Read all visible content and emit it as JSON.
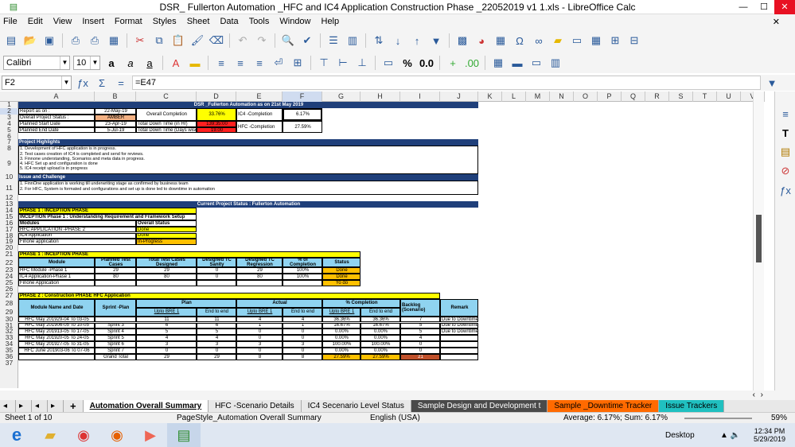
{
  "window": {
    "title": "DSR_ Fullerton Automation _HFC and IC4 Application Construction Phase _22052019 v1 1.xls - LibreOffice Calc"
  },
  "menu": [
    "File",
    "Edit",
    "View",
    "Insert",
    "Format",
    "Styles",
    "Sheet",
    "Data",
    "Tools",
    "Window",
    "Help"
  ],
  "font": {
    "name": "Calibri",
    "size": "10"
  },
  "formula": {
    "cellref": "F2",
    "content": "=E47"
  },
  "columns": [
    "A",
    "B",
    "C",
    "D",
    "E",
    "F",
    "G",
    "H",
    "I",
    "J",
    "K",
    "L",
    "M",
    "N",
    "O",
    "P",
    "Q",
    "R",
    "S",
    "T",
    "U",
    "V"
  ],
  "rows": [
    "1",
    "2",
    "3",
    "4",
    "5",
    "6",
    "7",
    "8",
    "9",
    "10",
    "11",
    "12",
    "13",
    "14",
    "15",
    "16",
    "17",
    "18",
    "19",
    "20",
    "21",
    "22",
    "23",
    "24",
    "25",
    "26",
    "27",
    "28",
    "29",
    "30",
    "31",
    "32",
    "33",
    "34",
    "35",
    "36",
    "37"
  ],
  "sheet": {
    "title": "DSR _Fullerton  Automation as on 21st May 2019",
    "report_as_on_label": "Report as on :",
    "report_as_on": "22-May-19",
    "overall_status_label": "Overall Project Status :",
    "overall_status": "AMBER",
    "planned_start_label": "Planned Start Date",
    "planned_start": "23-Apr-19",
    "planned_end_label": "Planned End Date",
    "planned_end": "5-Jul-19",
    "overall_completion_label": "Overall Completion",
    "overall_completion": "33.76%",
    "downtime_hr_label": "Total Down Time (in Hr)",
    "downtime_hr": "139:35:00",
    "downtime_days_label": "Total Down Time (Days wise)",
    "downtime_days": "19.00",
    "ic4_completion_label": "IC4 -Completion",
    "ic4_completion": "6.17%",
    "hfc_completion_label": "HFC -Completion",
    "hfc_completion": "27.59%",
    "highlights_label": "Project Highlights",
    "highlights": [
      "1. Development of HFC application is in progress.",
      "2. Test cases creation of IC4 is completed and send for reviews.",
      "3. Finnone understanding, Scenarios and meta data in progress.",
      "4. HFC Set up and configuration is done",
      "5. IC4 receipt upload is in progress"
    ],
    "issue_label": "Issue and Challenge",
    "issues": [
      "1. FinnOne application is working till underwriting stage as confirmed by business team",
      "2. For HFC, System is formated and configurations and set up is done led to downtime in automation"
    ],
    "current_status": "Current Project Status : Fullerton Automation",
    "phase1_label": "PHASE 1 : INCEPTION PHASE",
    "phase1_sub": "INCEPTION Phase  1 : Understanding Requirement and Framework Setup",
    "mod_hdr": "Modules",
    "ovs_hdr": "Overall Status",
    "mods": [
      {
        "name": "HFC APPLICATION -PHASE 2",
        "status": "Done"
      },
      {
        "name": "IC4 Application",
        "status": "Done"
      },
      {
        "name": "Finone application",
        "status": "In-Progress"
      }
    ],
    "phase1b_label": "PHASE 1 : INCEPTION PHASE",
    "t2_headers": [
      "Module",
      "Planned Test Cases",
      "Total Test Cases Designed",
      "Designed TC Sanity",
      "Designed TC Regression",
      "% of Completion",
      "Status"
    ],
    "t2_rows": [
      [
        "HFC Module -Phase 1",
        "29",
        "29",
        "0",
        "29",
        "100%",
        "Done"
      ],
      [
        "IC4 Application-Phase 1",
        "80",
        "80",
        "0",
        "80",
        "100%",
        "Done"
      ],
      [
        "Finone Application",
        "",
        "",
        "",
        "",
        "",
        "Yo do"
      ]
    ],
    "phase2_label": "PHASE 2 : Construction PHASE HFC Application",
    "t3_top": [
      "Module Name and Date",
      "Sprint -Plan",
      "Plan",
      "Actual",
      "% Completion",
      "Backlog (Scenario)",
      "Remark"
    ],
    "t3_sub": [
      "Upto BRE 1",
      "End to end",
      "Upto BRE 1",
      "End to end",
      "Upto BRE 1",
      "End to end"
    ],
    "t3_rows": [
      [
        "HFC May 2019",
        "29-04 To 03-05",
        "",
        "11",
        "11",
        "4",
        "4",
        "36.36%",
        "36.36%",
        "7",
        "Due to Downtime"
      ],
      [
        "HFC May 2019",
        "06-05 To 10-05",
        "Sprint 3",
        "6",
        "6",
        "1",
        "1",
        "16.67%",
        "16.67%",
        "5",
        "Due to Downtime"
      ],
      [
        "HFC May 2019",
        "13-05 To 17-05",
        "Sprint 4",
        "5",
        "5",
        "0",
        "0",
        "0.00%",
        "0.00%",
        "5",
        "Due to Downtime"
      ],
      [
        "HFC May 2019",
        "20-05 To 24-05",
        "Sprint 5",
        "4",
        "4",
        "0",
        "0",
        "0.00%",
        "0.00%",
        "4",
        ""
      ],
      [
        "HFC May 2019",
        "27-05 To 31-05",
        "Sprint 6",
        "3",
        "3",
        "3",
        "3",
        "100.00%",
        "100.00%",
        "0",
        ""
      ],
      [
        "HFC June 2019",
        "03-06 To 07-06",
        "Sprint 7",
        "0",
        "0",
        "0",
        "0",
        "0.00%",
        "0.00%",
        "0",
        ""
      ],
      [
        "",
        "",
        "Grand Total",
        "29",
        "29",
        "8",
        "8",
        "27.59%",
        "27.59%",
        "21",
        ""
      ]
    ]
  },
  "tabs": [
    "Automation Overall Summary",
    "HFC -Scenario Details",
    "IC4 Secenario Level Status",
    "Sample Design and Development t",
    "Sample _Downtime Tracker",
    "Issue Trackers"
  ],
  "status": {
    "sheet": "Sheet 1 of 10",
    "style": "PageStyle_Automation Overall Summary",
    "lang": "English (USA)",
    "sum": "Average: 6.17%; Sum: 6.17%",
    "zoom": "59%"
  },
  "taskbar": {
    "desktop": "Desktop",
    "time": "12:34 PM",
    "date": "5/29/2019"
  }
}
